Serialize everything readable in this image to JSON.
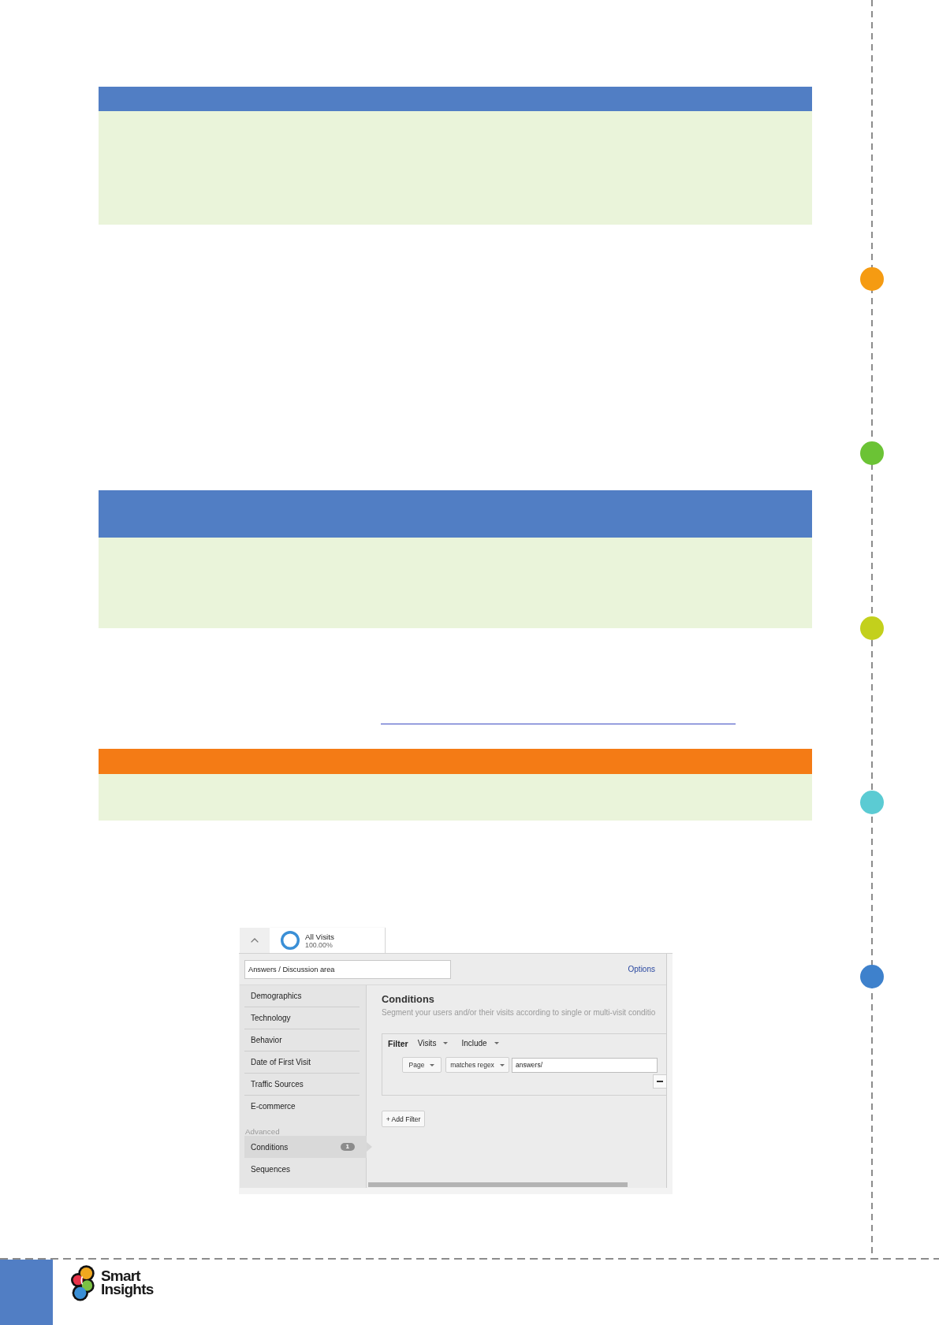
{
  "callouts": [
    {
      "color": "#517ec4"
    },
    {
      "color": "#517ec4"
    },
    {
      "color": "#f47b15"
    }
  ],
  "segment_editor": {
    "segment_tab": {
      "title": "All Visits",
      "share": "100.00%"
    },
    "name_field": {
      "value": "Answers / Discussion area"
    },
    "options_link": "Options",
    "nav": {
      "items": [
        {
          "label": "Demographics",
          "selected": false
        },
        {
          "label": "Technology",
          "selected": false
        },
        {
          "label": "Behavior",
          "selected": false
        },
        {
          "label": "Date of First Visit",
          "selected": false
        },
        {
          "label": "Traffic Sources",
          "selected": false
        },
        {
          "label": "E-commerce",
          "selected": false
        }
      ],
      "advanced_label": "Advanced",
      "advanced_items": [
        {
          "label": "Conditions",
          "selected": true,
          "badge": "1"
        },
        {
          "label": "Sequences",
          "selected": false
        }
      ]
    },
    "conditions": {
      "title": "Conditions",
      "description": "Segment your users and/or their visits according to single or multi-visit conditio",
      "filter": {
        "label": "Filter",
        "scope": "Visits",
        "mode": "Include",
        "dimension": "Page",
        "operator": "matches regex",
        "value": "answers/"
      },
      "add_filter": "+ Add Filter"
    }
  },
  "timeline": {
    "dots": [
      {
        "color": "#f59b12"
      },
      {
        "color": "#6bc335"
      },
      {
        "color": "#c3d01c"
      },
      {
        "color": "#5bcbd3"
      },
      {
        "color": "#3e81cc"
      }
    ]
  },
  "footer": {
    "logo_text": "Smart Insights"
  }
}
